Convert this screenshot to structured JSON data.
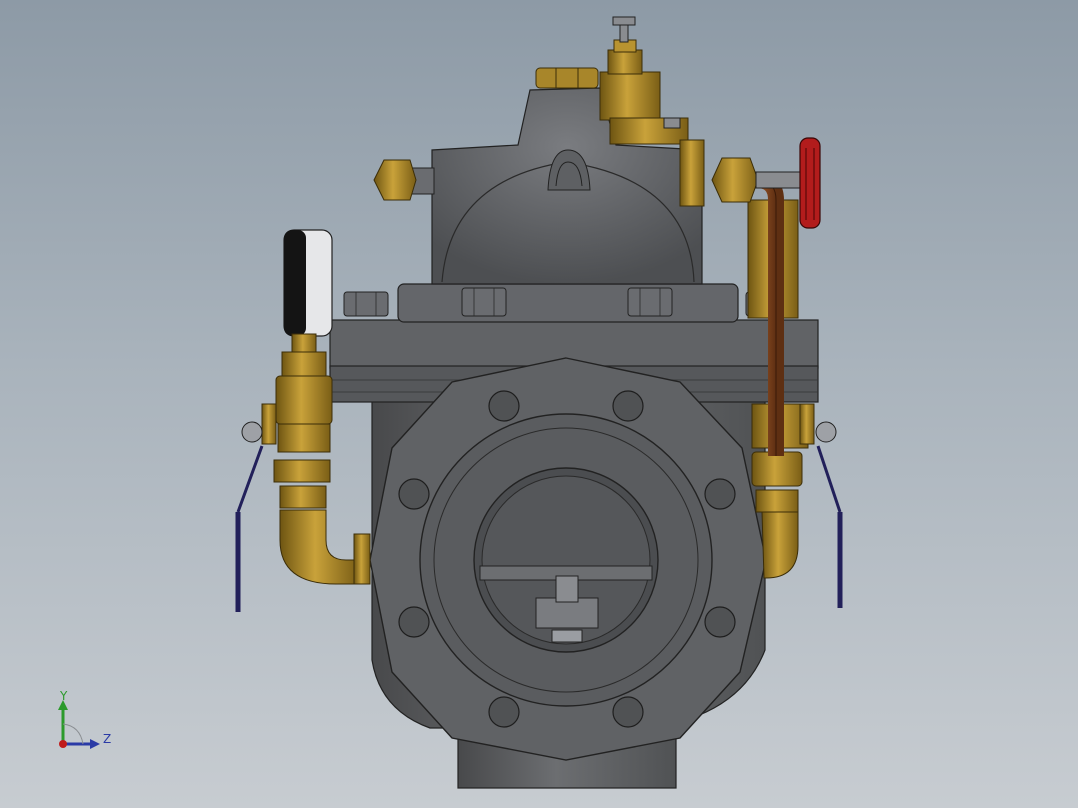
{
  "scene": {
    "background_top": "#8d9aa6",
    "background_bottom": "#c7ccd1",
    "body_color": "#5f6164",
    "brass_color": "#a8862a",
    "copper_color": "#8a4a22",
    "handwheel_color": "#b21c1c",
    "handle_color": "#22205a"
  },
  "triad": {
    "y_label": "Y",
    "z_label": "Z",
    "y_color": "#2c9a2c",
    "z_color": "#2a3aa6",
    "x_color": "#c01b1b"
  }
}
